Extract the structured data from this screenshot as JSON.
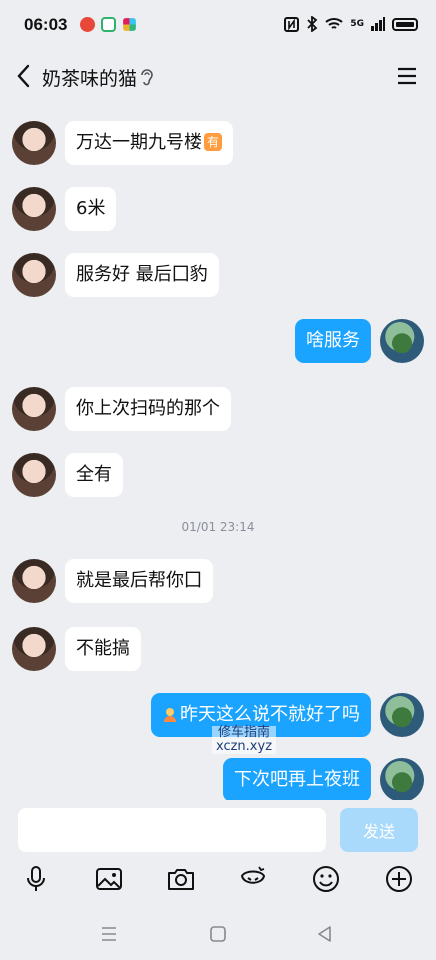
{
  "status_bar": {
    "time": "06:03",
    "network": "5G"
  },
  "header": {
    "title": "奶茶味的猫"
  },
  "messages": [
    {
      "side": "in",
      "text": "万达一期九号楼",
      "badge": "有"
    },
    {
      "side": "in",
      "text": "6米"
    },
    {
      "side": "in",
      "text": "服务好 最后囗豹"
    },
    {
      "side": "out",
      "text": "啥服务"
    },
    {
      "side": "in",
      "text": "你上次扫码的那个"
    },
    {
      "side": "in",
      "text": "全有"
    },
    {
      "side": "in",
      "text": "就是最后帮你囗"
    },
    {
      "side": "in",
      "text": "不能搞"
    },
    {
      "side": "out",
      "text": "昨天这么说不就好了吗"
    },
    {
      "side": "out",
      "text": "下次吧再上夜班"
    }
  ],
  "timestamp": "01/01 23:14",
  "watermark": {
    "line1": "修车指南",
    "line2": "xczn.xyz"
  },
  "input": {
    "value": "",
    "send_label": "发送"
  },
  "toolbar": [
    "microphone-icon",
    "image-icon",
    "camera-icon",
    "effects-icon",
    "emoji-icon",
    "plus-icon"
  ],
  "colors": {
    "outgoing_bubble": "#1aa3ff",
    "send_button": "#a9d9fb",
    "background": "#eceef2"
  }
}
